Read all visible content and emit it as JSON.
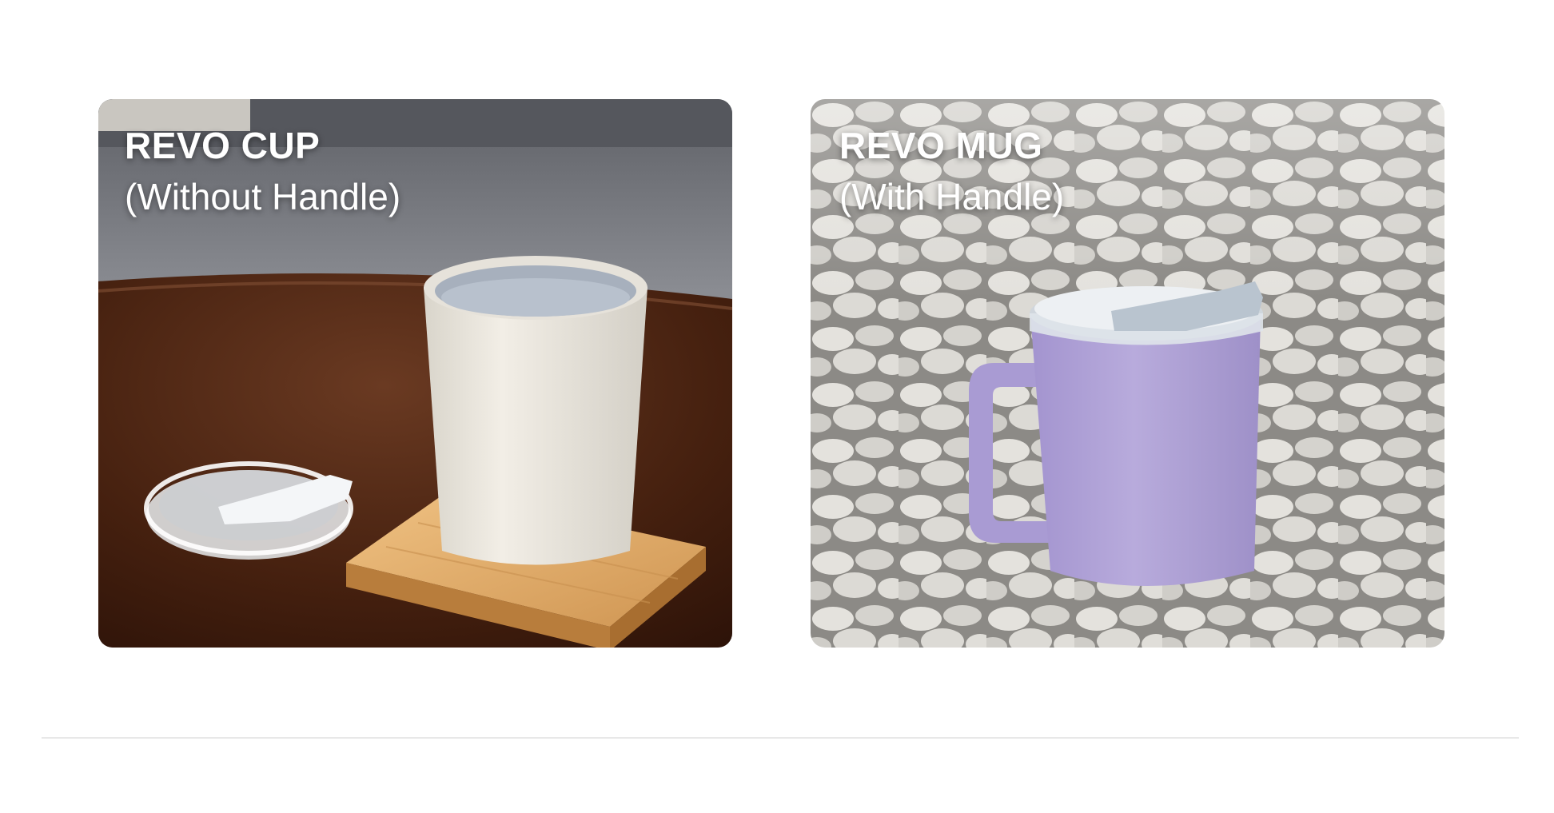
{
  "products": {
    "cup": {
      "title": "REVO CUP",
      "subtitle": "(Without Handle)"
    },
    "mug": {
      "title": "REVO MUG",
      "subtitle": "(With Handle)"
    }
  },
  "colors": {
    "cup_body": "#ece8df",
    "mug_body": "#b3a6d9",
    "table": "#4a2414",
    "coaster": "#e6b06b",
    "sofa": "#7a7c82",
    "pebbles": "#d9d7d2"
  }
}
